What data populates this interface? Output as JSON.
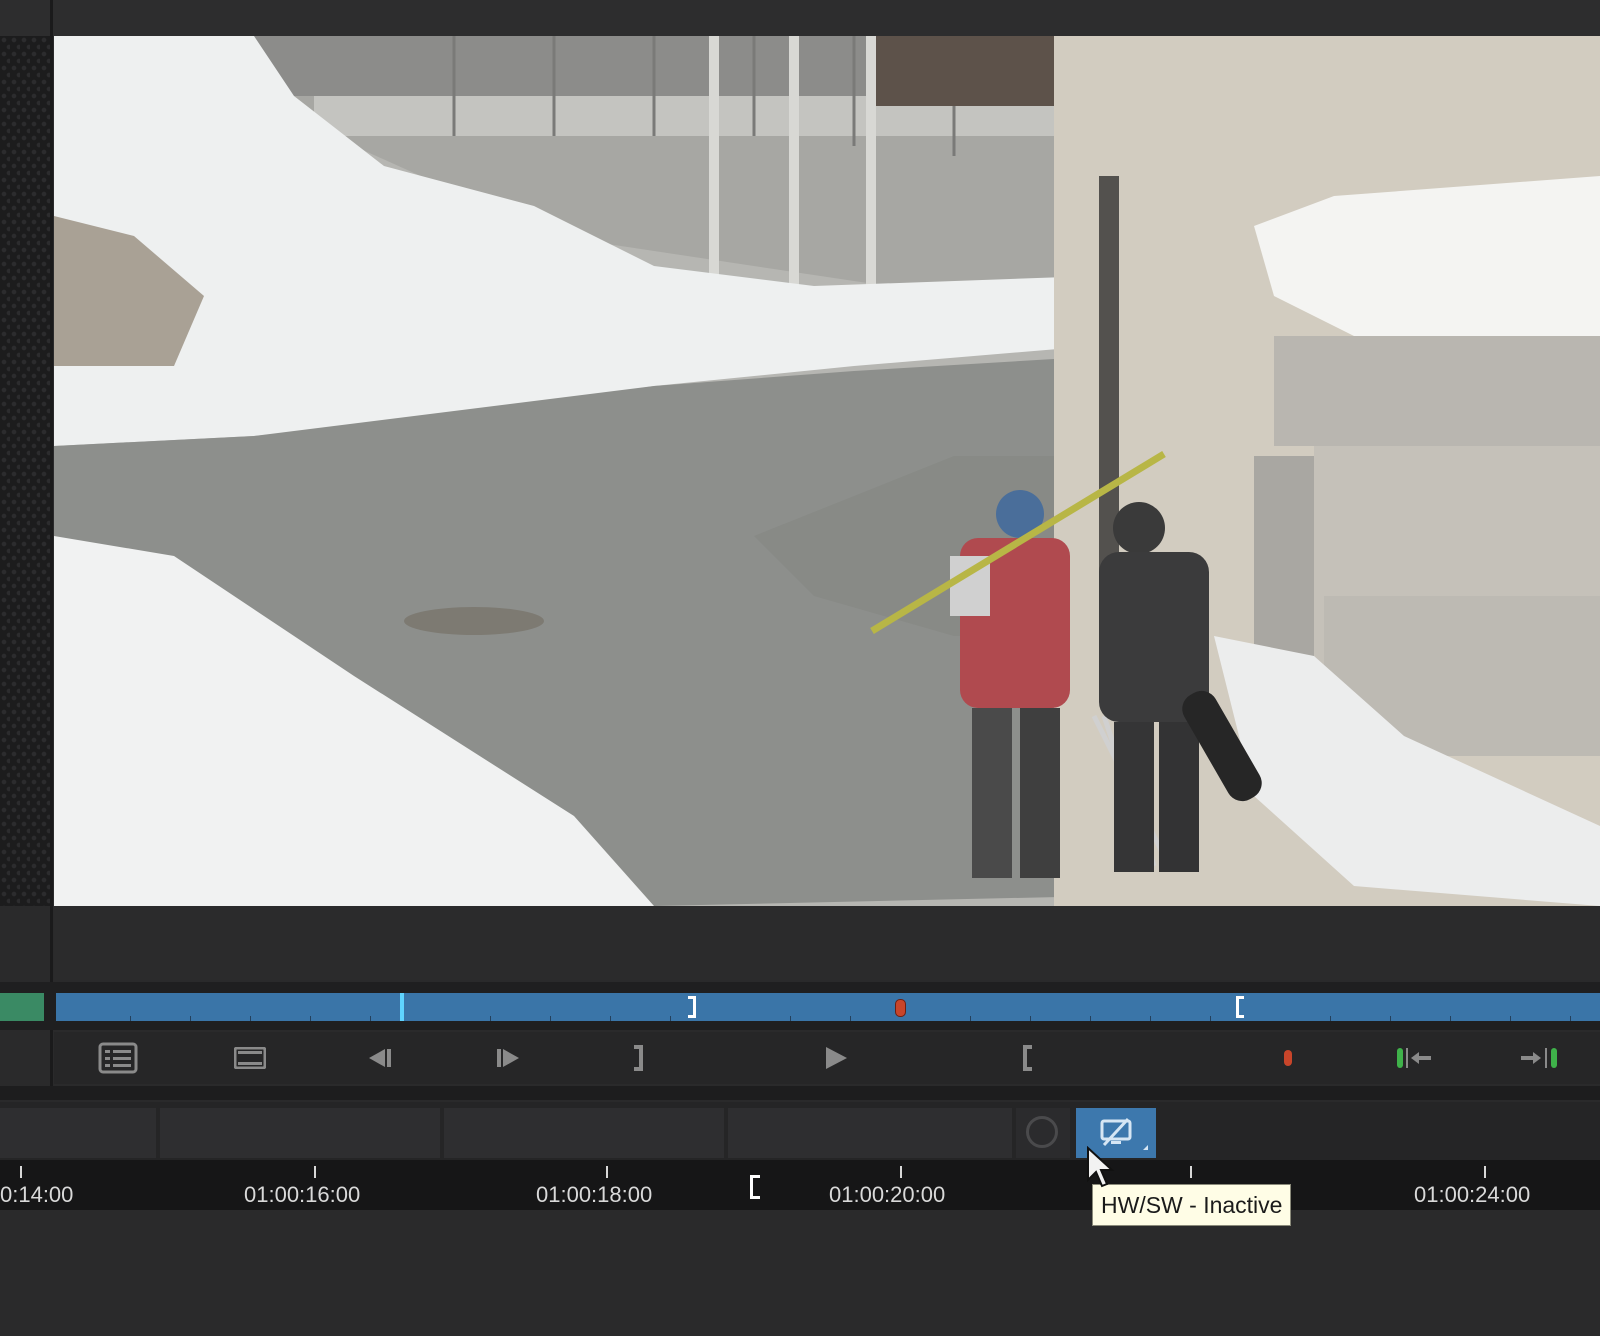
{
  "viewer": {
    "frame": "video frame: two people walking up a snowy street carrying skis and a snowboard"
  },
  "transport": {
    "buttons": [
      {
        "name": "clip-list-icon"
      },
      {
        "name": "filmstrip-icon"
      },
      {
        "name": "previous-frame-icon"
      },
      {
        "name": "next-frame-icon"
      },
      {
        "name": "mark-out-icon"
      },
      {
        "name": "play-icon"
      },
      {
        "name": "mark-in-icon"
      },
      {
        "name": "add-marker-icon"
      },
      {
        "name": "go-to-in-icon"
      },
      {
        "name": "go-to-out-icon"
      }
    ]
  },
  "scrubber": {
    "colors": {
      "track": "#3a75a8",
      "playhead": "#5fd4ff",
      "marker": "#c8452a",
      "green": "#3a8a64"
    }
  },
  "track_header": {
    "record_icon": "record-circle-icon",
    "hwsw_icon": "monitor-off-icon"
  },
  "ruler": {
    "timecodes": [
      "0:14:00",
      "01:00:16:00",
      "01:00:18:00",
      "01:00:20:00",
      "01:00:24:00"
    ]
  },
  "tooltip": {
    "text": "HW/SW - Inactive"
  }
}
